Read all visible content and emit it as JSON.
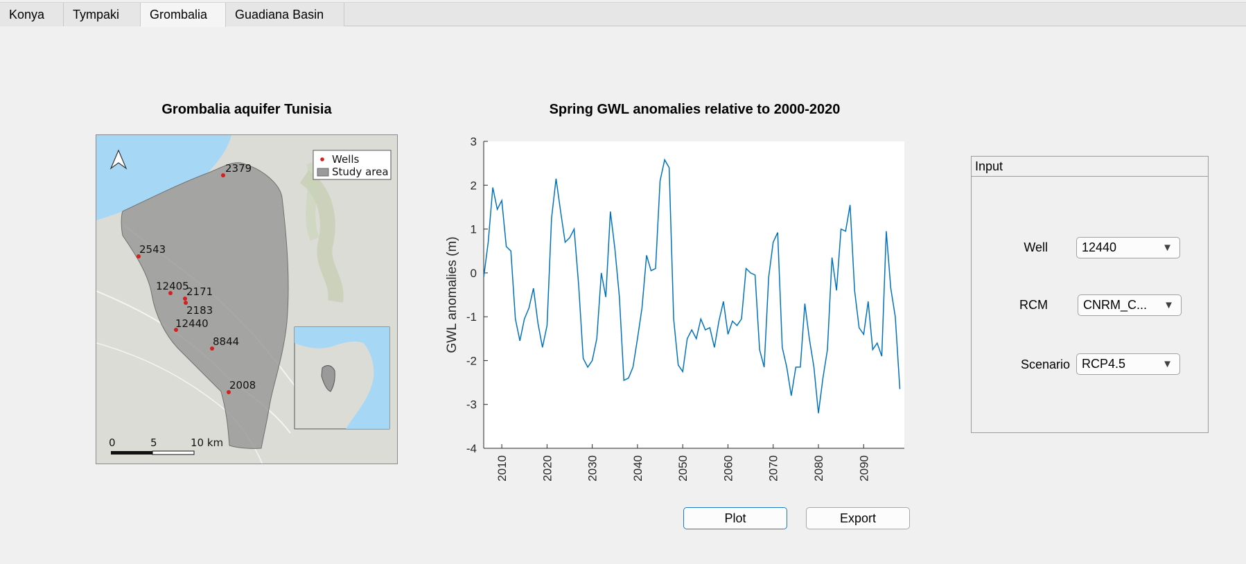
{
  "tabs": [
    {
      "label": "Konya"
    },
    {
      "label": "Tympaki"
    },
    {
      "label": "Grombalia",
      "active": true
    },
    {
      "label": "Guadiana Basin"
    }
  ],
  "map_panel": {
    "title": "Grombalia aquifer Tunisia",
    "legend": {
      "wells": "Wells",
      "study_area": "Study area"
    },
    "wells": [
      {
        "label": "2379"
      },
      {
        "label": "2543"
      },
      {
        "label": "12405"
      },
      {
        "label": "2171"
      },
      {
        "label": "2183"
      },
      {
        "label": "12440"
      },
      {
        "label": "8844"
      },
      {
        "label": "2008"
      }
    ],
    "scalebar": {
      "t0": "0",
      "t5": "5",
      "t10": "10 km"
    },
    "colors": {
      "water": "#a6d8f5",
      "land": "#dcdcd6",
      "study_area": "#9a9a9a",
      "well": "#d42020"
    }
  },
  "chart_panel": {
    "title": "Spring GWL anomalies relative to 2000-2020"
  },
  "chart_data": {
    "type": "line",
    "title": "Spring GWL anomalies relative to 2000-2020",
    "xlabel": "",
    "ylabel": "GWL anomalies (m)",
    "xlim": [
      2006,
      2099
    ],
    "ylim": [
      -4,
      3
    ],
    "xticks": [
      2010,
      2020,
      2030,
      2040,
      2050,
      2060,
      2070,
      2080,
      2090
    ],
    "yticks": [
      -4,
      -3,
      -2,
      -1,
      0,
      1,
      2,
      3
    ],
    "color": "#0072bd",
    "x": [
      2006,
      2007,
      2008,
      2009,
      2010,
      2011,
      2012,
      2013,
      2014,
      2015,
      2016,
      2017,
      2018,
      2019,
      2020,
      2021,
      2022,
      2023,
      2024,
      2025,
      2026,
      2027,
      2028,
      2029,
      2030,
      2031,
      2032,
      2033,
      2034,
      2035,
      2036,
      2037,
      2038,
      2039,
      2040,
      2041,
      2042,
      2043,
      2044,
      2045,
      2046,
      2047,
      2048,
      2049,
      2050,
      2051,
      2052,
      2053,
      2054,
      2055,
      2056,
      2057,
      2058,
      2059,
      2060,
      2061,
      2062,
      2063,
      2064,
      2065,
      2066,
      2067,
      2068,
      2069,
      2070,
      2071,
      2072,
      2073,
      2074,
      2075,
      2076,
      2077,
      2078,
      2079,
      2080,
      2081,
      2082,
      2083,
      2084,
      2085,
      2086,
      2087,
      2088,
      2089,
      2090,
      2091,
      2092,
      2093,
      2094,
      2095,
      2096,
      2097,
      2098,
      2099
    ],
    "y": [
      -0.1,
      0.7,
      1.95,
      1.45,
      1.65,
      0.6,
      0.5,
      -1.05,
      -1.55,
      -1.05,
      -0.8,
      -0.35,
      -1.15,
      -1.7,
      -1.2,
      1.25,
      2.15,
      1.4,
      0.7,
      0.8,
      1.0,
      -0.3,
      -1.95,
      -2.15,
      -2.0,
      -1.5,
      0.0,
      -0.55,
      1.4,
      0.55,
      -0.55,
      -2.45,
      -2.4,
      -2.15,
      -1.5,
      -0.8,
      0.4,
      0.05,
      0.1,
      2.1,
      2.58,
      2.4,
      -1.05,
      -2.1,
      -2.25,
      -1.5,
      -1.3,
      -1.5,
      -1.05,
      -1.3,
      -1.25,
      -1.7,
      -1.1,
      -0.65,
      -1.4,
      -1.1,
      -1.2,
      -1.05,
      0.1,
      0.0,
      -0.05,
      -1.75,
      -2.15,
      -0.1,
      0.7,
      0.92,
      -1.7,
      -2.15,
      -2.8,
      -2.15,
      -2.15,
      -0.7,
      -1.5,
      -2.15,
      -3.2,
      -2.4,
      -1.75,
      0.35,
      -0.4,
      1.0,
      0.95,
      1.55,
      -0.4,
      -1.25,
      -1.4,
      -0.65,
      -1.75,
      -1.6,
      -1.9,
      0.95,
      -0.35,
      -1.0,
      -2.65
    ]
  },
  "buttons": {
    "plot": "Plot",
    "export": "Export"
  },
  "input_panel": {
    "title": "Input",
    "well": {
      "label": "Well",
      "value": "12440"
    },
    "rcm": {
      "label": "RCM",
      "value": "CNRM_C..."
    },
    "scenario": {
      "label": "Scenario",
      "value": "RCP4.5"
    }
  }
}
